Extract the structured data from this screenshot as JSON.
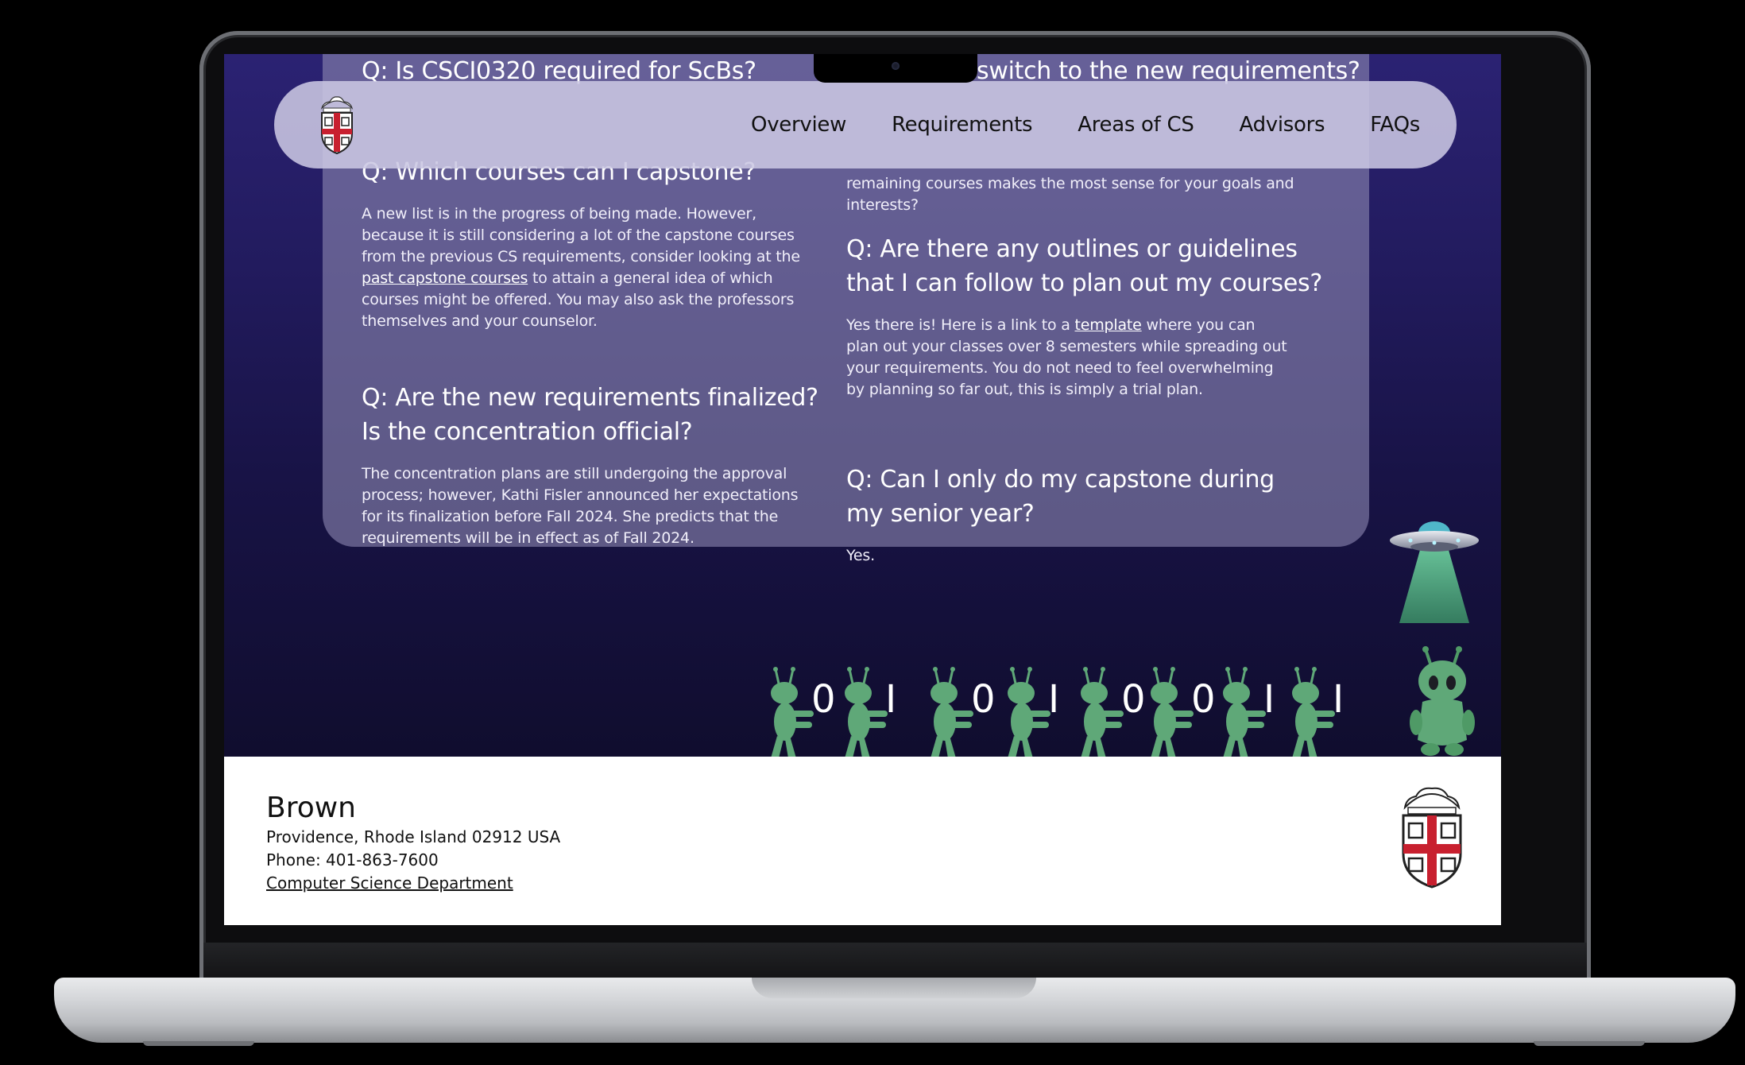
{
  "navbar": {
    "logo_alt": "Brown University seal",
    "links": [
      {
        "label": "Overview"
      },
      {
        "label": "Requirements"
      },
      {
        "label": "Areas of CS"
      },
      {
        "label": "Advisors"
      },
      {
        "label": "FAQs"
      }
    ]
  },
  "faq": {
    "left": [
      {
        "question": "Q: Is CSCI0320 required for ScBs?"
      },
      {
        "question": "Q: Which courses can I capstone?",
        "answer_parts": [
          "A new list is in the progress of being made. However, because it is still considering a lot of the capstone courses from the previous CS requirements, consider looking at the ",
          "past capstone courses",
          " to attain a general idea of which courses might be offered. You may also ask the professors themselves and your counselor."
        ]
      },
      {
        "question": "Q: Are the new requirements finalized? Is the concentration official?",
        "answer": "The concentration plans are still undergoing the approval process; however, Kathi Fisler announced her expectations for its finalization before Fall 2024. She predicts that the requirements will be in effect as of Fall 2024."
      }
    ],
    "right": [
      {
        "question": "switch to the new requirements?"
      },
      {
        "answer_tail": "remaining courses makes the most sense for your goals and interests?"
      },
      {
        "question": "Q: Are there any outlines or guidelines that I can follow to plan out my courses?",
        "answer_parts": [
          "Yes there is! Here is a link to a ",
          "template",
          " where you can plan out your classes over 8 semesters while spreading out your requirements.  You do not need to feel overwhelming by planning so far out, this is simply a trial plan."
        ]
      },
      {
        "question": "Q: Can I only do my capstone during my senior year?",
        "answer": "Yes."
      }
    ]
  },
  "binary_digits": [
    "0",
    "I",
    "0",
    "I",
    "0",
    "0",
    "I",
    "I"
  ],
  "footer": {
    "title": "Brown",
    "address": "Providence, Rhode Island 02912 USA",
    "phone": "Phone: 401-863-7600",
    "link": "Computer Science Department"
  },
  "colors": {
    "page_bg_top": "#2b2273",
    "page_bg_bottom": "#100d2e",
    "card": "#8a86b0",
    "navbar": "#cbc7e2",
    "alien_green": "#5fa878",
    "brown_red": "#c8202f"
  }
}
